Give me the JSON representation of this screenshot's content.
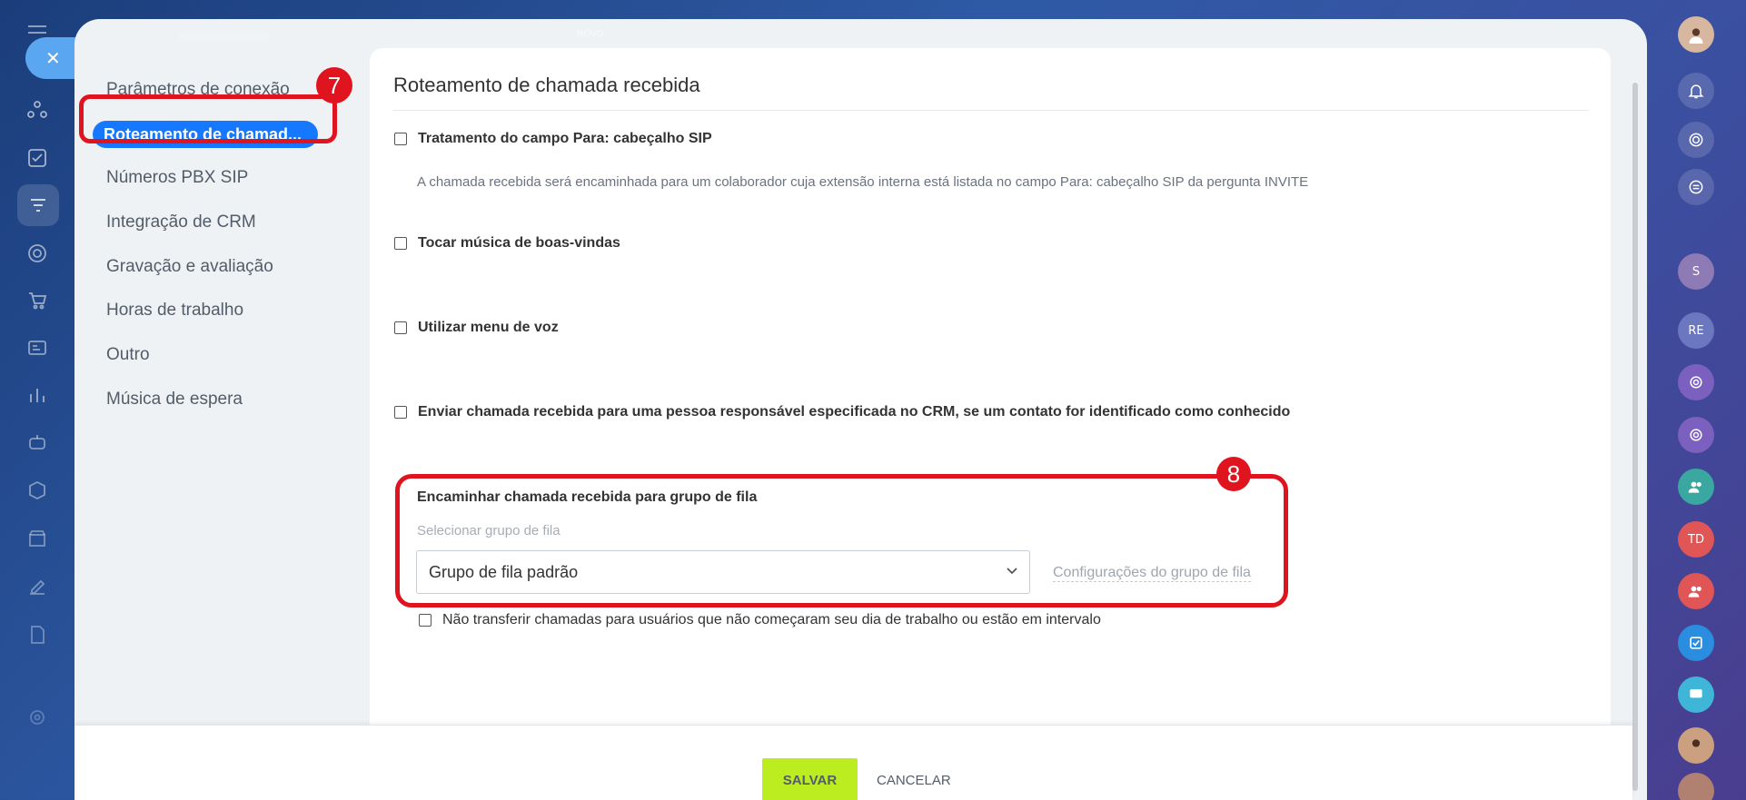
{
  "header": {
    "ghost_label": "NOVO"
  },
  "sidebar": {
    "items": [
      {
        "label": "Parâmetros de conexão"
      },
      {
        "label": "Roteamento de chamad..."
      },
      {
        "label": "Números PBX SIP"
      },
      {
        "label": "Integração de CRM"
      },
      {
        "label": "Gravação e avaliação"
      },
      {
        "label": "Horas de trabalho"
      },
      {
        "label": "Outro"
      },
      {
        "label": "Música de espera"
      }
    ],
    "active_index": 1
  },
  "annotations": {
    "step7": "7",
    "step8": "8"
  },
  "content": {
    "title": "Roteamento de chamada recebida",
    "options": [
      {
        "label": "Tratamento do campo Para: cabeçalho SIP",
        "checked": false
      },
      {
        "label": "Tocar música de boas-vindas",
        "checked": false
      },
      {
        "label": "Utilizar menu de voz",
        "checked": false
      },
      {
        "label": "Enviar chamada recebida para uma pessoa responsável especificada no CRM, se um contato for identificado como conhecido",
        "checked": false
      }
    ],
    "sip_hint": "A chamada recebida será encaminhada para um colaborador cuja extensão interna está listada no campo Para: cabeçalho SIP da pergunta INVITE",
    "queue": {
      "title": "Encaminhar chamada recebida para grupo de fila",
      "subtitle": "Selecionar grupo de fila",
      "selected": "Grupo de fila padrão",
      "settings_link": "Configurações do grupo de fila"
    },
    "no_transfer": {
      "label": "Não transferir chamadas para usuários que não começaram seu dia de trabalho ou estão em intervalo",
      "checked": false
    }
  },
  "footer": {
    "save_label": "SALVAR",
    "cancel_label": "CANCELAR"
  },
  "rightbar": {
    "avatar_s": "S",
    "avatar_re": "RE",
    "avatar_td": "TD"
  },
  "colors": {
    "accent": "#1677ff",
    "save": "#bbed21",
    "marker": "#e0141e"
  }
}
